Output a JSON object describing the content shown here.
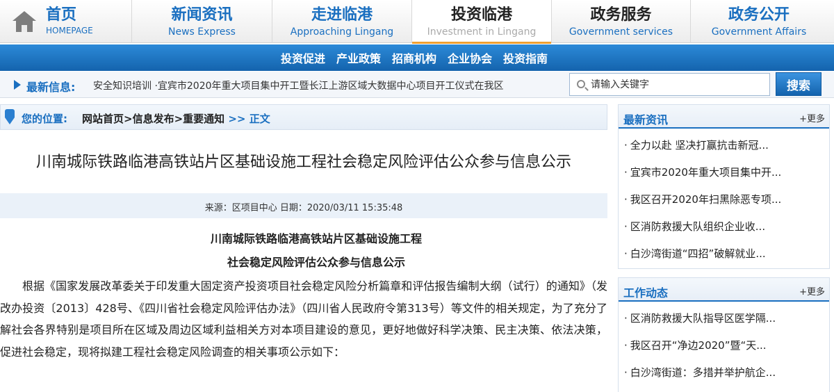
{
  "nav": {
    "home": {
      "cn": "首页",
      "en": "HOMEPAGE"
    },
    "items": [
      {
        "cn": "新闻资讯",
        "en": "News Express"
      },
      {
        "cn": "走进临港",
        "en": "Approaching Lingang"
      },
      {
        "cn": "投资临港",
        "en": "Investment in Lingang"
      },
      {
        "cn": "政务服务",
        "en": "Government services"
      },
      {
        "cn": "政务公开",
        "en": "Government Affairs"
      }
    ]
  },
  "subnav": [
    "投资促进",
    "产业政策",
    "招商机构",
    "企业协会",
    "投资指南"
  ],
  "ticker": {
    "label": "最新信息:",
    "text": "安全知识培训 ·宜宾市2020年重大项目集中开工暨长江上游区域大数据中心项目开工仪式在我区"
  },
  "search": {
    "placeholder": "请输入关键字",
    "button": "搜索"
  },
  "breadcrumb": {
    "label": "您的位置:",
    "path": "网站首页>信息发布>重要通知",
    "sep": " >> ",
    "current": "正文"
  },
  "article": {
    "title": "川南城际铁路临港高铁站片区基础设施工程社会稳定风险评估公众参与信息公示",
    "meta": "来源：区项目中心 日期：2020/03/11 15:35:48",
    "subtitle_1": "川南城际铁路临港高铁站片区基础设施工程",
    "subtitle_2": "社会稳定风险评估公众参与信息公示",
    "body": "根据《国家发展改革委关于印发重大固定资产投资项目社会稳定风险分析篇章和评估报告编制大纲（试行）的通知》（发改办投资〔2013〕428号、《四川省社会稳定风险评估办法》（四川省人民政府令第313号）等文件的相关规定，为了充分了解社会各界特别是项目所在区域及周边区域利益相关方对本项目建设的意见，更好地做好科学决策、民主决策、依法决策，促进社会稳定，现将拟建工程社会稳定风险调查的相关事项公示如下："
  },
  "sidebar": {
    "news": {
      "title": "最新资讯",
      "more": "+更多",
      "items": [
        "全力以赴 坚决打赢抗击新冠...",
        "宜宾市2020年重大项目集中开...",
        "我区召开2020年扫黑除恶专项...",
        "区消防救援大队组织企业收...",
        "白沙湾街道“四招”破解就业..."
      ]
    },
    "work": {
      "title": "工作动态",
      "more": "+更多",
      "items": [
        "区消防救援大队指导区医学隔...",
        "我区召开“净边2020”暨“天...",
        "白沙湾街道：多措并举护航企..."
      ]
    }
  }
}
